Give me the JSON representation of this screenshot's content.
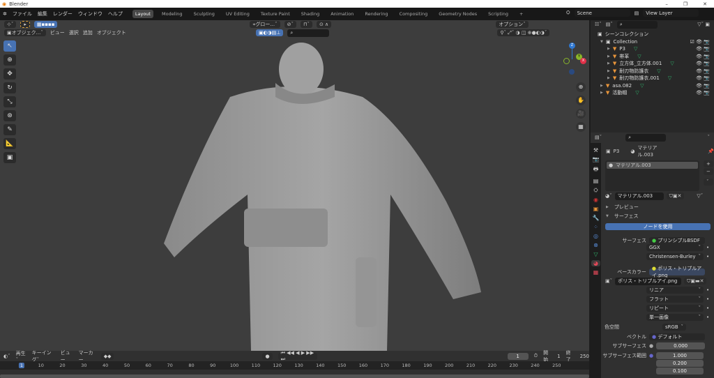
{
  "window": {
    "title": "Blender",
    "min": "–",
    "max": "❐",
    "close": "✕"
  },
  "menu": [
    "ファイル",
    "編集",
    "レンダー",
    "ウィンドウ",
    "ヘルプ"
  ],
  "workspaces": [
    "Layout",
    "Modeling",
    "Sculpting",
    "UV Editing",
    "Texture Paint",
    "Shading",
    "Animation",
    "Rendering",
    "Compositing",
    "Geometry Nodes",
    "Scripting",
    "+"
  ],
  "scene": {
    "scene": "Scene",
    "view_layer": "View Layer"
  },
  "viewport": {
    "mode": "オブジェク...",
    "menus": [
      "ビュー",
      "選択",
      "追加",
      "オブジェクト"
    ],
    "transform": "グロー...",
    "options": "オプション"
  },
  "gizmo": {
    "z": "Z",
    "y": "Y",
    "x": "X"
  },
  "outliner": {
    "root": "シーンコレクション",
    "collection": "Collection",
    "items": [
      {
        "name": "P3",
        "indent": 2
      },
      {
        "name": "帯革",
        "indent": 2
      },
      {
        "name": "立方体_立方体.001",
        "indent": 2
      },
      {
        "name": "耐刃物防護衣",
        "indent": 2
      },
      {
        "name": "耐刃物防護衣.001",
        "indent": 2
      },
      {
        "name": "asa.082",
        "indent": 1
      },
      {
        "name": "活動帽",
        "indent": 1
      }
    ]
  },
  "properties": {
    "object": "P3",
    "material": "マテリアル.003",
    "slot": "マテリアル.003",
    "mat_field": "マテリアル.003",
    "preview": "プレビュー",
    "surface_panel": "サーフェス",
    "use_nodes": "ノードを使用",
    "surface_label": "サーフェス",
    "surface_value": "プリンシプルBSDF",
    "distribution": "GGX",
    "subsurface_method": "Christensen-Burley",
    "base_color_label": "ベースカラー",
    "base_color_value": "ポリス・トリプルアイ.png",
    "image": "ポリス・トリプルアイ.png",
    "interp": "リニア",
    "projection": "フラット",
    "extension": "リピート",
    "source": "単一画像",
    "colorspace_label": "色空間",
    "colorspace": "sRGB",
    "vector_label": "ベクトル",
    "vector": "デフォルト",
    "subsurface_label": "サブサーフェス",
    "subsurface": "0.000",
    "ss_radius_label": "サブサーフェス範囲",
    "ss_radius": [
      "1.000",
      "0.200",
      "0.100"
    ]
  },
  "timeline": {
    "menus": [
      "再生",
      "キーイング",
      "ビュー",
      "マーカー"
    ],
    "current": "1",
    "start_label": "開始",
    "start": "1",
    "end_label": "終了",
    "end": "250",
    "ticks": [
      "1",
      "10",
      "20",
      "30",
      "40",
      "50",
      "60",
      "70",
      "80",
      "90",
      "100",
      "110",
      "120",
      "130",
      "140",
      "150",
      "160",
      "170",
      "180",
      "190",
      "200",
      "210",
      "220",
      "230",
      "240",
      "250"
    ]
  }
}
